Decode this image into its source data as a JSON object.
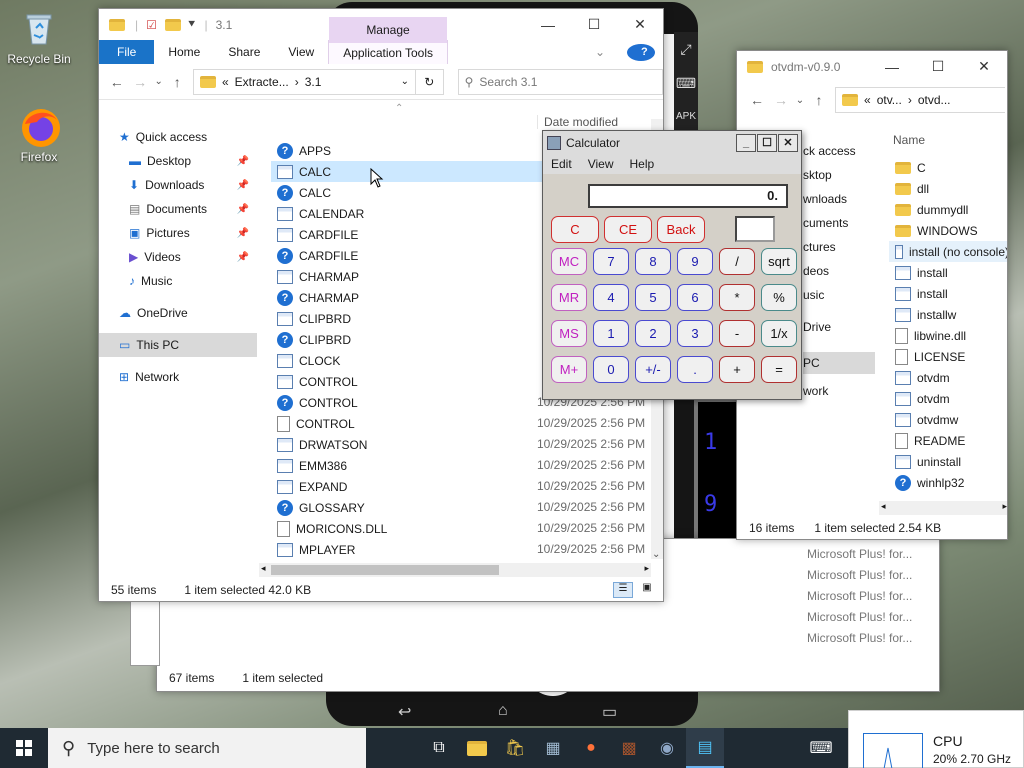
{
  "desktop": {
    "recycle_bin": "Recycle Bin",
    "firefox": "Firefox"
  },
  "explorer_main": {
    "path_title": "3.1",
    "manage_tab": "Manage",
    "tabs": [
      "File",
      "Home",
      "Share",
      "View",
      "Application Tools"
    ],
    "address": {
      "prefix": "«",
      "crumb1": "Extracte...",
      "sep": "›",
      "crumb2": "3.1"
    },
    "search_placeholder": "Search 3.1",
    "column_date": "Date modified",
    "nav_items": [
      {
        "label": "Quick access",
        "icon": "star-icon"
      },
      {
        "label": "Desktop",
        "icon": "desktop-icon",
        "pinned": true
      },
      {
        "label": "Downloads",
        "icon": "download-icon",
        "pinned": true
      },
      {
        "label": "Documents",
        "icon": "documents-icon",
        "pinned": true
      },
      {
        "label": "Pictures",
        "icon": "pictures-icon",
        "pinned": true
      },
      {
        "label": "Videos",
        "icon": "videos-icon",
        "pinned": true
      },
      {
        "label": "Music",
        "icon": "music-icon"
      },
      {
        "label": "OneDrive",
        "icon": "cloud-icon"
      },
      {
        "label": "This PC",
        "icon": "computer-icon"
      },
      {
        "label": "Network",
        "icon": "network-icon"
      }
    ],
    "files": [
      {
        "name": "APPS",
        "icon": "help"
      },
      {
        "name": "CALC",
        "icon": "exe"
      },
      {
        "name": "CALC",
        "icon": "help"
      },
      {
        "name": "CALENDAR",
        "icon": "exe"
      },
      {
        "name": "CARDFILE",
        "icon": "exe"
      },
      {
        "name": "CARDFILE",
        "icon": "help"
      },
      {
        "name": "CHARMAP",
        "icon": "exe"
      },
      {
        "name": "CHARMAP",
        "icon": "help"
      },
      {
        "name": "CLIPBRD",
        "icon": "exe"
      },
      {
        "name": "CLIPBRD",
        "icon": "help"
      },
      {
        "name": "CLOCK",
        "icon": "exe"
      },
      {
        "name": "CONTROL",
        "icon": "exe"
      },
      {
        "name": "CONTROL",
        "icon": "help"
      },
      {
        "name": "CONTROL",
        "icon": "doc"
      },
      {
        "name": "DRWATSON",
        "icon": "exe"
      },
      {
        "name": "EMM386",
        "icon": "exe"
      },
      {
        "name": "EXPAND",
        "icon": "exe"
      },
      {
        "name": "GLOSSARY",
        "icon": "help"
      },
      {
        "name": "MORICONS.DLL",
        "icon": "doc"
      },
      {
        "name": "MPLAYER",
        "icon": "exe"
      }
    ],
    "dates": [
      "10/29/2025 2:56 PM",
      "10/29/2025 2:56 PM",
      "10/29/2025 2:56 PM",
      "10/29/2025 2:56 PM",
      "10/29/2025 2:56 PM",
      "10/29/2025 2:56 PM",
      "10/29/2025 2:56 PM",
      "10/29/2025 2:56 PM",
      "10/29/2025 2:56 PM"
    ],
    "status_items": "55 items",
    "status_selected": "1 item selected  42.0 KB"
  },
  "calculator": {
    "title": "Calculator",
    "menu": [
      "Edit",
      "View",
      "Help"
    ],
    "display": "0.",
    "buttons": {
      "c": "C",
      "ce": "CE",
      "back": "Back",
      "mc": "MC",
      "mr": "MR",
      "ms": "MS",
      "mplus": "M+",
      "n7": "7",
      "n8": "8",
      "n9": "9",
      "div": "/",
      "sqrt": "sqrt",
      "n4": "4",
      "n5": "5",
      "n6": "6",
      "mul": "*",
      "pct": "%",
      "n1": "1",
      "n2": "2",
      "n3": "3",
      "sub": "-",
      "recip": "1/x",
      "n0": "0",
      "sign": "+/-",
      "dot": ".",
      "add": "+",
      "eq": "="
    }
  },
  "explorer_otvdm": {
    "title": "otvdm-v0.9.0",
    "address": {
      "prefix": "«",
      "crumb1": "otv...",
      "sep": "›",
      "crumb2": "otvd..."
    },
    "column_name": "Name",
    "nav_partial": [
      "ck access",
      "sktop",
      "wnloads",
      "cuments",
      "ctures",
      "deos",
      "usic",
      "Drive",
      "PC",
      "work"
    ],
    "files": [
      {
        "name": "C",
        "icon": "folder"
      },
      {
        "name": "dll",
        "icon": "folder"
      },
      {
        "name": "dummydll",
        "icon": "folder"
      },
      {
        "name": "WINDOWS",
        "icon": "folder"
      },
      {
        "name": "install (no console)",
        "icon": "exe"
      },
      {
        "name": "install",
        "icon": "exe"
      },
      {
        "name": "install",
        "icon": "exe"
      },
      {
        "name": "installw",
        "icon": "exe"
      },
      {
        "name": "libwine.dll",
        "icon": "doc"
      },
      {
        "name": "LICENSE",
        "icon": "doc"
      },
      {
        "name": "otvdm",
        "icon": "exe"
      },
      {
        "name": "otvdm",
        "icon": "exe"
      },
      {
        "name": "otvdmw",
        "icon": "exe"
      },
      {
        "name": "README",
        "icon": "doc"
      },
      {
        "name": "uninstall",
        "icon": "exe"
      },
      {
        "name": "winhlp32",
        "icon": "help"
      }
    ],
    "status_items": "16 items",
    "status_selected": "1 item selected  2.54 KB"
  },
  "background_window": {
    "rows": [
      "Microsoft Plus! for...",
      "Microsoft Plus! for...",
      "Microsoft Plus! for...",
      "Microsoft Plus! for...",
      "Microsoft Plus! for..."
    ],
    "status_items": "67 items",
    "status_selected": "1 item selected"
  },
  "taskbar": {
    "search_placeholder": "Type here to search",
    "cpu_label": "CPU",
    "cpu_value": "20%  2.70 GHz"
  }
}
